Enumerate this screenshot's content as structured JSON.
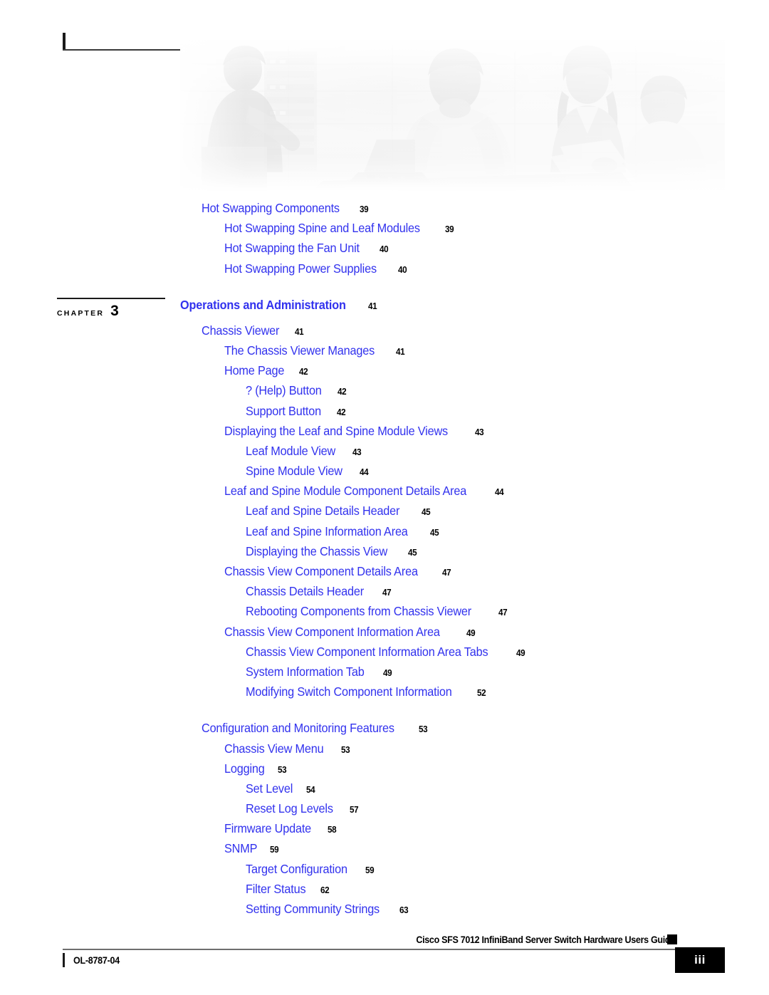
{
  "page": {
    "document_title": "Cisco SFS 7012 InfiniBand Server Switch Hardware Users Guide",
    "doc_number": "OL-8787-04",
    "page_number": "iii"
  },
  "banner": {
    "alt": "cisco-people-banner-image"
  },
  "chapter_marker": {
    "label": "CHAPTER",
    "number": "3"
  },
  "toc": [
    {
      "title": "Hot Swapping Components",
      "page": "39",
      "level": 2
    },
    {
      "title": "Hot Swapping Spine and Leaf Modules",
      "page": "39",
      "level": 3
    },
    {
      "title": "Hot Swapping the Fan Unit",
      "page": "40",
      "level": 3
    },
    {
      "title": "Hot Swapping Power Supplies",
      "page": "40",
      "level": 3
    },
    {
      "title": "Operations and Administration",
      "page": "41",
      "level": 1
    },
    {
      "title": "Chassis Viewer",
      "page": "41",
      "level": 2
    },
    {
      "title": "The Chassis Viewer Manages",
      "page": "41",
      "level": 3
    },
    {
      "title": "Home Page",
      "page": "42",
      "level": 3
    },
    {
      "title": "? (Help) Button",
      "page": "42",
      "level": 4
    },
    {
      "title": "Support Button",
      "page": "42",
      "level": 4
    },
    {
      "title": "Displaying the Leaf and Spine Module Views",
      "page": "43",
      "level": 3
    },
    {
      "title": "Leaf Module View",
      "page": "43",
      "level": 4
    },
    {
      "title": "Spine Module View",
      "page": "44",
      "level": 4
    },
    {
      "title": "Leaf and Spine Module Component Details Area",
      "page": "44",
      "level": 3
    },
    {
      "title": "Leaf and Spine Details Header",
      "page": "45",
      "level": 4
    },
    {
      "title": "Leaf and Spine Information Area",
      "page": "45",
      "level": 4
    },
    {
      "title": "Displaying the Chassis View",
      "page": "45",
      "level": 4
    },
    {
      "title": "Chassis View Component Details Area",
      "page": "47",
      "level": 3
    },
    {
      "title": "Chassis Details Header",
      "page": "47",
      "level": 4
    },
    {
      "title": "Rebooting Components from Chassis Viewer",
      "page": "47",
      "level": 4
    },
    {
      "title": "Chassis View Component Information Area",
      "page": "49",
      "level": 3
    },
    {
      "title": "Chassis View Component Information Area Tabs",
      "page": "49",
      "level": 4
    },
    {
      "title": "System Information Tab",
      "page": "49",
      "level": 4
    },
    {
      "title": "Modifying Switch Component Information",
      "page": "52",
      "level": 4
    },
    {
      "title": "Configuration and Monitoring Features",
      "page": "53",
      "level": 2
    },
    {
      "title": "Chassis View Menu",
      "page": "53",
      "level": 3
    },
    {
      "title": "Logging",
      "page": "53",
      "level": 3
    },
    {
      "title": "Set Level",
      "page": "54",
      "level": 4
    },
    {
      "title": "Reset Log Levels",
      "page": "57",
      "level": 4
    },
    {
      "title": "Firmware Update",
      "page": "58",
      "level": 3
    },
    {
      "title": "SNMP",
      "page": "59",
      "level": 3
    },
    {
      "title": "Target Configuration",
      "page": "59",
      "level": 4
    },
    {
      "title": "Filter Status",
      "page": "62",
      "level": 4
    },
    {
      "title": "Setting Community Strings",
      "page": "63",
      "level": 4
    }
  ],
  "colors": {
    "link_blue": "#3232ee",
    "text_black": "#000000"
  }
}
